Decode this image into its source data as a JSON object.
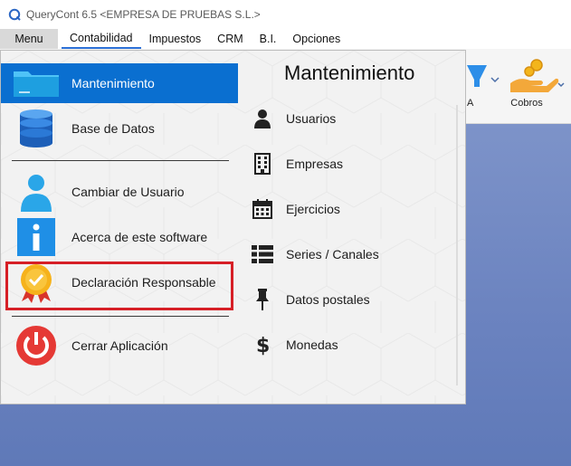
{
  "window": {
    "title": "QueryCont 6.5 <EMPRESA DE PRUEBAS S.L.>"
  },
  "menubar": {
    "menu_label": "Menu",
    "tabs": [
      "Contabilidad",
      "Impuestos",
      "CRM",
      "B.I.",
      "Opciones"
    ],
    "active_tab": "Contabilidad"
  },
  "ribbon": {
    "partial_label": "A",
    "cobros_label": "Cobros"
  },
  "left_menu": {
    "items": [
      {
        "label": "Mantenimiento",
        "icon": "folder-icon"
      },
      {
        "label": "Base de Datos",
        "icon": "database-icon"
      },
      {
        "label": "Cambiar de Usuario",
        "icon": "user-icon"
      },
      {
        "label": "Acerca de este software",
        "icon": "info-icon"
      },
      {
        "label": "Declaración Responsable",
        "icon": "badge-check-icon"
      },
      {
        "label": "Cerrar Aplicación",
        "icon": "power-icon"
      }
    ],
    "selected": "Mantenimiento",
    "highlighted": "Declaración Responsable"
  },
  "submenu": {
    "title": "Mantenimiento",
    "items": [
      {
        "label": "Usuarios",
        "icon": "user-icon"
      },
      {
        "label": "Empresas",
        "icon": "building-icon"
      },
      {
        "label": "Ejercicios",
        "icon": "calendar-icon"
      },
      {
        "label": "Series / Canales",
        "icon": "list-icon"
      },
      {
        "label": "Datos postales",
        "icon": "pin-icon"
      },
      {
        "label": "Monedas",
        "icon": "dollar-icon"
      }
    ]
  },
  "colors": {
    "selected_bg": "#0a6fd0",
    "highlight_border": "#d61f26",
    "desktop": "#6f86bf"
  }
}
